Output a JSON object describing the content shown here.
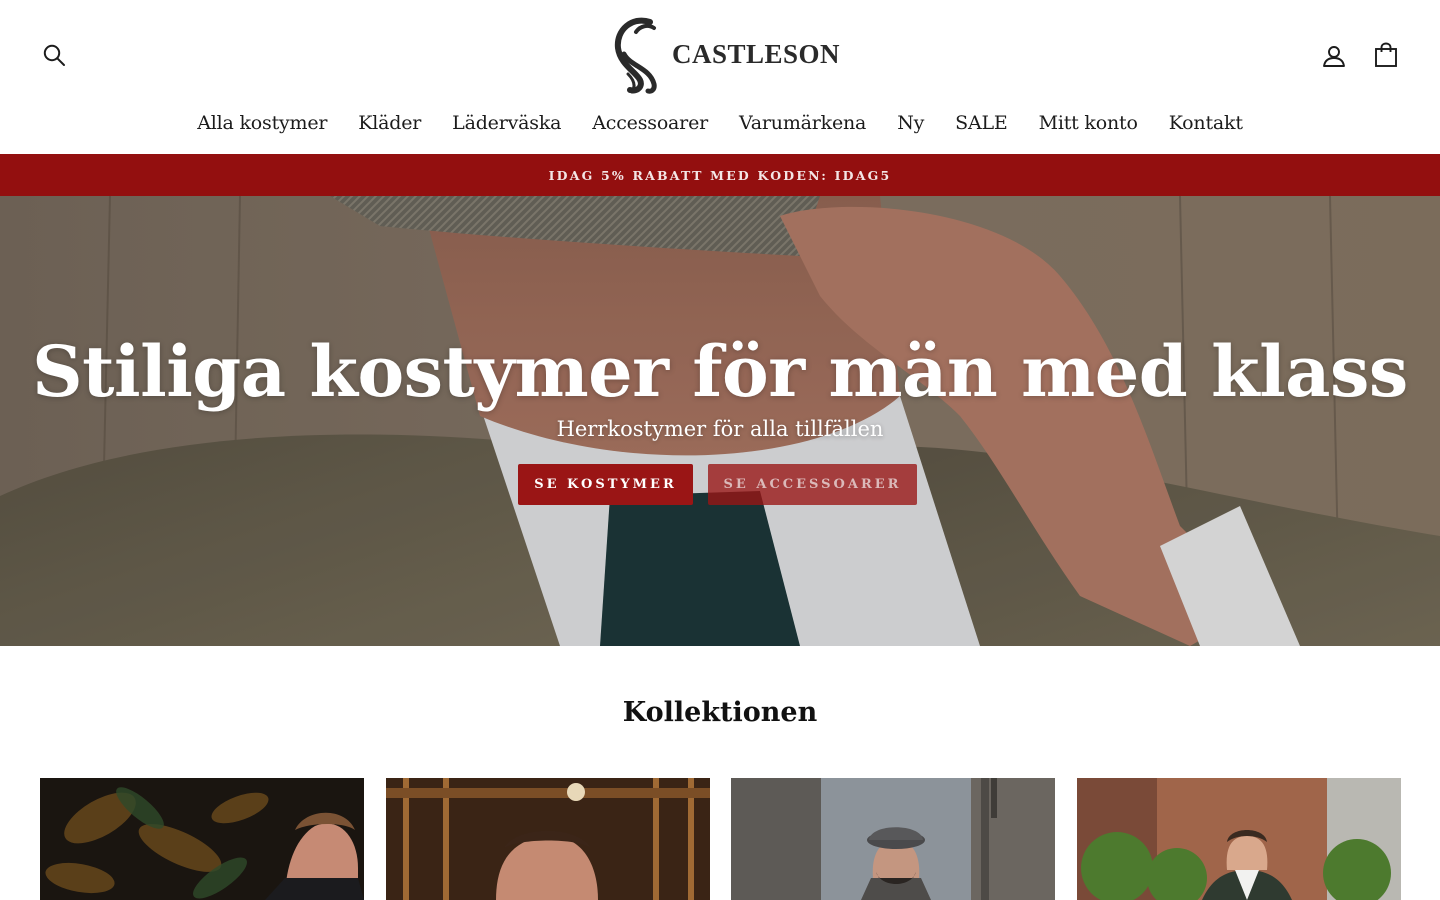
{
  "brand": {
    "name": "CASTLESON"
  },
  "header": {
    "icons": {
      "search": "search-icon",
      "account": "user-icon",
      "cart": "shopping-bag-icon"
    }
  },
  "nav": {
    "items": [
      {
        "label": "Alla kostymer"
      },
      {
        "label": "Kläder"
      },
      {
        "label": "Läderväska"
      },
      {
        "label": "Accessoarer"
      },
      {
        "label": "Varumärkena"
      },
      {
        "label": "Ny"
      },
      {
        "label": "SALE"
      },
      {
        "label": "Mitt konto"
      },
      {
        "label": "Kontakt"
      }
    ]
  },
  "promo": {
    "text": "IDAG 5% RABATT MED KODEN: IDAG5",
    "color": "#930f0f"
  },
  "hero": {
    "title": "Stiliga kostymer för män med klass",
    "subtitle": "Herrkostymer för alla tillfällen",
    "buttons": [
      {
        "label": "SE KOSTYMER"
      },
      {
        "label": "SE ACCESSOARER"
      }
    ]
  },
  "collection": {
    "title": "Kollektionen",
    "cards": [
      {
        "name": "collection-card-1"
      },
      {
        "name": "collection-card-2"
      },
      {
        "name": "collection-card-3"
      },
      {
        "name": "collection-card-4"
      }
    ]
  },
  "colors": {
    "accent": "#9a1515",
    "text": "#1c1c1c",
    "background": "#ffffff"
  }
}
